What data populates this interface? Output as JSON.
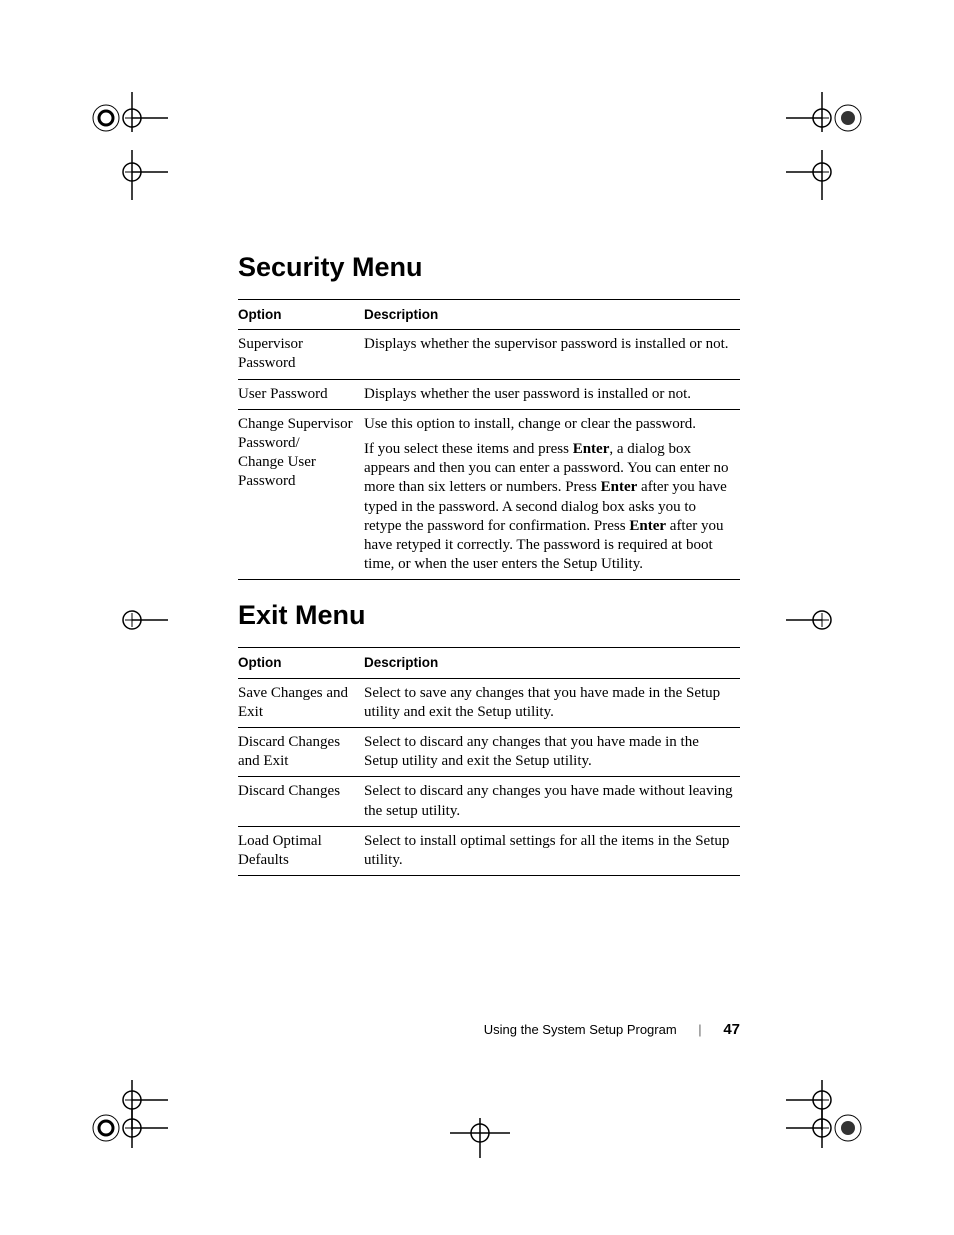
{
  "headings": {
    "security": "Security Menu",
    "exit": "Exit Menu"
  },
  "columns": {
    "option": "Option",
    "description": "Description"
  },
  "security_rows": [
    {
      "option": "Supervisor Password",
      "desc": "Displays whether the supervisor password is installed or not."
    },
    {
      "option": "User Password",
      "desc": "Displays whether the user password is installed or not."
    },
    {
      "option": "Change Supervisor Password/\nChange User Password",
      "desc_parts": [
        {
          "t": "Use this option to install, change or clear the password."
        },
        {
          "t": "If you select these items and press "
        },
        {
          "b": "Enter"
        },
        {
          "t": ", a dialog box appears and then you can enter a password. You can enter no more than six letters or numbers. Press "
        },
        {
          "b": "Enter"
        },
        {
          "t": " after you have typed in the password. A second dialog box asks you to retype the password for confirmation. Press "
        },
        {
          "b": "Enter"
        },
        {
          "t": " after you have retyped it correctly. The password is required at boot time, or when the user enters the Setup Utility."
        }
      ]
    }
  ],
  "exit_rows": [
    {
      "option": "Save Changes and Exit",
      "desc": "Select to save any changes that you have made in the Setup utility and exit the Setup utility."
    },
    {
      "option": "Discard Changes and Exit",
      "desc": "Select to discard any changes that you have made in the Setup utility and exit the Setup utility."
    },
    {
      "option": "Discard Changes",
      "desc": "Select to discard any changes you have made without leaving the setup utility."
    },
    {
      "option": "Load Optimal Defaults",
      "desc": "Select to install optimal settings for all the items in the Setup utility."
    }
  ],
  "footer": {
    "title": "Using the System Setup Program",
    "page": "47"
  }
}
